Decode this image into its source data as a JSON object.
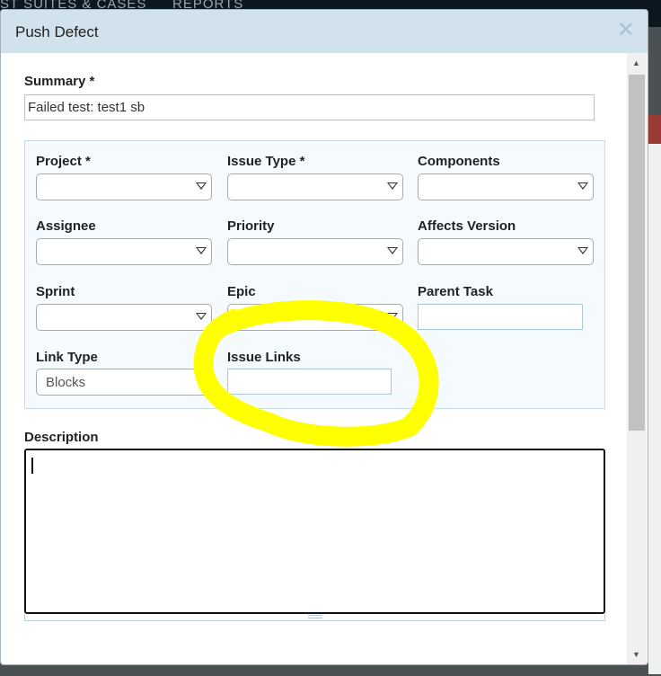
{
  "background": {
    "nav_items": [
      "ST SUITES & CASES",
      "REPORTS"
    ]
  },
  "dialog": {
    "title": "Push Defect",
    "close_icon": "close-icon",
    "summary": {
      "label": "Summary *",
      "value": "Failed test: test1 sb"
    },
    "fields": {
      "project": {
        "label": "Project *",
        "value": ""
      },
      "issue_type": {
        "label": "Issue Type *",
        "value": ""
      },
      "components": {
        "label": "Components",
        "value": ""
      },
      "assignee": {
        "label": "Assignee",
        "value": ""
      },
      "priority": {
        "label": "Priority",
        "value": ""
      },
      "affects_version": {
        "label": "Affects Version",
        "value": ""
      },
      "sprint": {
        "label": "Sprint",
        "value": ""
      },
      "epic": {
        "label": "Epic",
        "value": ""
      },
      "parent_task": {
        "label": "Parent Task",
        "value": ""
      },
      "link_type": {
        "label": "Link Type",
        "value": "Blocks"
      },
      "issue_links": {
        "label": "Issue Links",
        "value": ""
      }
    },
    "description": {
      "label": "Description",
      "value": ""
    }
  },
  "annotation": {
    "color": "#ffff00"
  }
}
